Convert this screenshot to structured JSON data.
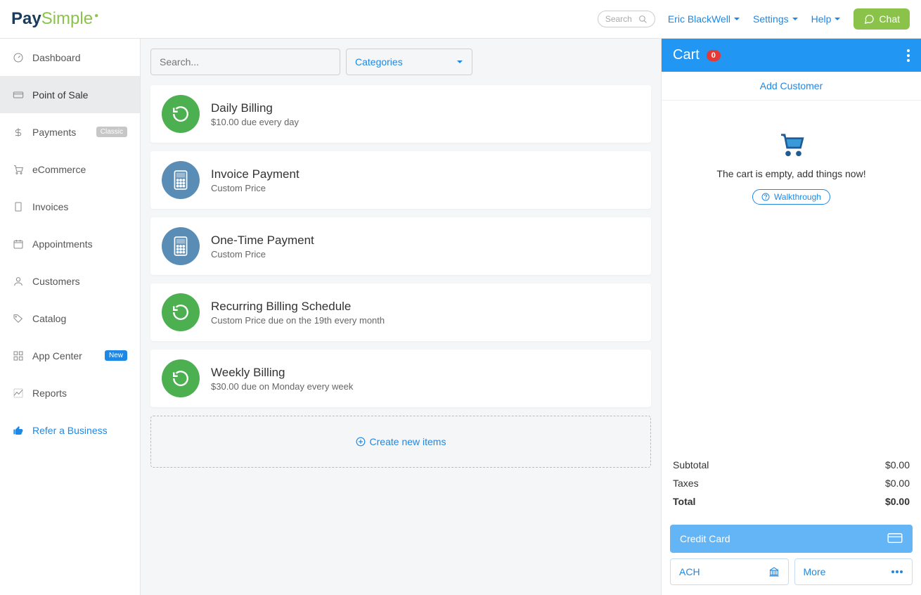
{
  "header": {
    "logo_pay": "Pay",
    "logo_simple": "Simple",
    "search_placeholder": "Search",
    "user": "Eric BlackWell",
    "settings": "Settings",
    "help": "Help",
    "chat": "Chat"
  },
  "sidebar": {
    "items": [
      {
        "label": "Dashboard"
      },
      {
        "label": "Point of Sale"
      },
      {
        "label": "Payments",
        "badge": "Classic"
      },
      {
        "label": "eCommerce"
      },
      {
        "label": "Invoices"
      },
      {
        "label": "Appointments"
      },
      {
        "label": "Customers"
      },
      {
        "label": "Catalog"
      },
      {
        "label": "App Center",
        "badge": "New"
      },
      {
        "label": "Reports"
      },
      {
        "label": "Refer a Business"
      }
    ]
  },
  "main": {
    "search_placeholder": "Search...",
    "categories_label": "Categories",
    "products": [
      {
        "title": "Daily Billing",
        "sub": "$10.00 due every day",
        "icon": "refresh",
        "color": "green"
      },
      {
        "title": "Invoice Payment",
        "sub": "Custom Price",
        "icon": "calculator",
        "color": "blue"
      },
      {
        "title": "One-Time Payment",
        "sub": "Custom Price",
        "icon": "calculator",
        "color": "blue"
      },
      {
        "title": "Recurring Billing Schedule",
        "sub": "Custom Price due on the 19th every month",
        "icon": "refresh",
        "color": "green"
      },
      {
        "title": "Weekly Billing",
        "sub": "$30.00 due on Monday every week",
        "icon": "refresh",
        "color": "green"
      }
    ],
    "create_new": "Create new items"
  },
  "cart": {
    "title": "Cart",
    "count": "0",
    "add_customer": "Add Customer",
    "empty_text": "The cart is empty, add things now!",
    "walkthrough": "Walkthrough",
    "subtotal_label": "Subtotal",
    "subtotal_value": "$0.00",
    "taxes_label": "Taxes",
    "taxes_value": "$0.00",
    "total_label": "Total",
    "total_value": "$0.00",
    "credit_card": "Credit Card",
    "ach": "ACH",
    "more": "More"
  }
}
